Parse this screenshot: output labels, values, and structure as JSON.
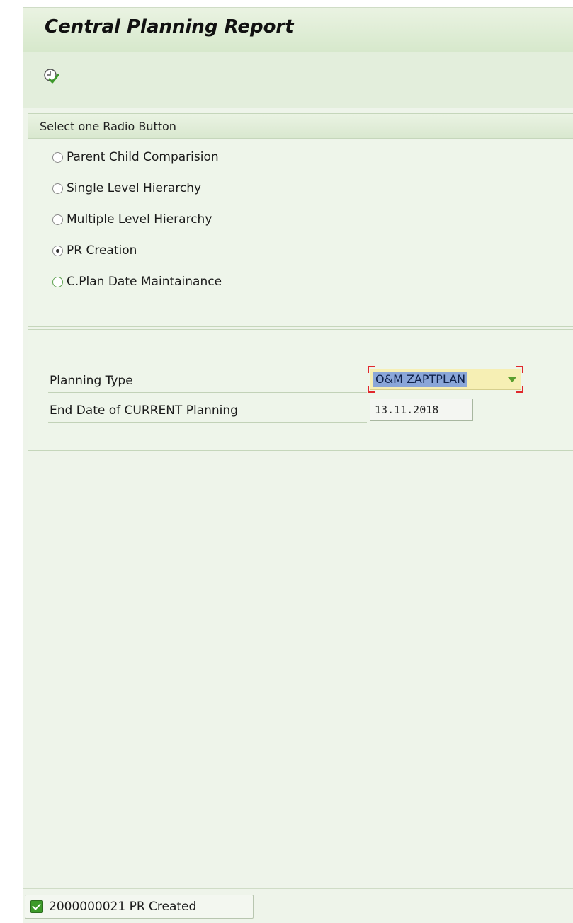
{
  "window": {
    "title": "Central Planning Report"
  },
  "toolbar": {
    "execute_icon": "execute-clock-check-icon"
  },
  "radio_group": {
    "title": "Select one Radio Button",
    "options": [
      {
        "label": "Parent Child Comparision",
        "selected": false
      },
      {
        "label": "Single Level Hierarchy",
        "selected": false
      },
      {
        "label": "Multiple Level Hierarchy",
        "selected": false
      },
      {
        "label": "PR Creation",
        "selected": true
      },
      {
        "label": "C.Plan Date Maintainance",
        "selected": false
      }
    ]
  },
  "fields": {
    "planning_type_label": "Planning Type",
    "planning_type_value": "O&M ZAPTPLAN",
    "end_date_label": "End Date of CURRENT Planning",
    "end_date_value": "13.11.2018"
  },
  "status": {
    "message": "2000000021 PR Created",
    "icon": "success-check-icon"
  },
  "colors": {
    "accent_green": "#3d9a2a",
    "selection_blue": "#8aa6d8",
    "required_red": "#e0282c",
    "dropdown_bg": "#f6efb4"
  }
}
